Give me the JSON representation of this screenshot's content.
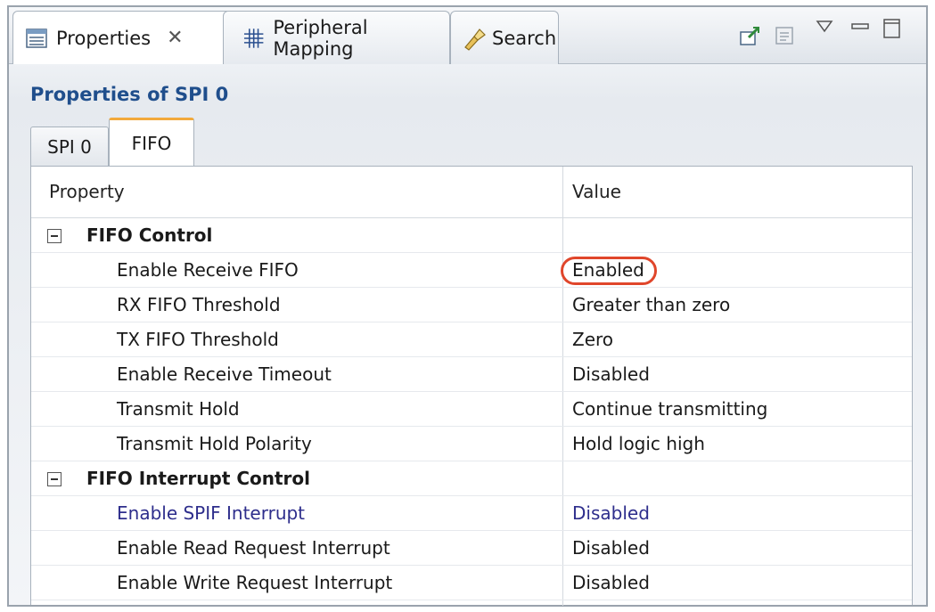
{
  "view_tabs": [
    {
      "label": "Properties",
      "icon": "properties-list-icon",
      "active": true
    },
    {
      "label": "Peripheral Mapping",
      "icon": "grid-icon",
      "active": false
    },
    {
      "label": "Search",
      "icon": "flashlight-icon",
      "active": false
    }
  ],
  "toolbar_icons": [
    "pin-editor-icon",
    "disabled-view-icon",
    "view-menu-icon",
    "minimize-icon",
    "maximize-icon"
  ],
  "panel_title": "Properties of SPI 0",
  "property_tabs": [
    {
      "label": "SPI 0",
      "active": false
    },
    {
      "label": "FIFO",
      "active": true
    }
  ],
  "columns": [
    "Property",
    "Value"
  ],
  "groups": [
    {
      "name": "FIFO Control",
      "rows": [
        {
          "name": "Enable Receive FIFO",
          "value": "Enabled",
          "highlighted": true
        },
        {
          "name": "RX FIFO Threshold",
          "value": "Greater than zero"
        },
        {
          "name": "TX FIFO Threshold",
          "value": "Zero"
        },
        {
          "name": "Enable Receive Timeout",
          "value": "Disabled"
        },
        {
          "name": "Transmit Hold",
          "value": "Continue transmitting"
        },
        {
          "name": "Transmit Hold Polarity",
          "value": "Hold logic high"
        }
      ]
    },
    {
      "name": "FIFO Interrupt Control",
      "rows": [
        {
          "name": "Enable SPIF Interrupt",
          "value": "Disabled",
          "link_color": true
        },
        {
          "name": "Enable Read Request Interrupt",
          "value": "Disabled"
        },
        {
          "name": "Enable Write Request Interrupt",
          "value": "Disabled"
        }
      ]
    }
  ],
  "colors": {
    "title": "#1f4e8c",
    "active_tab_accent": "#f2a93b",
    "highlight_ring": "#e0462b",
    "link_text": "#2e2e8c"
  }
}
